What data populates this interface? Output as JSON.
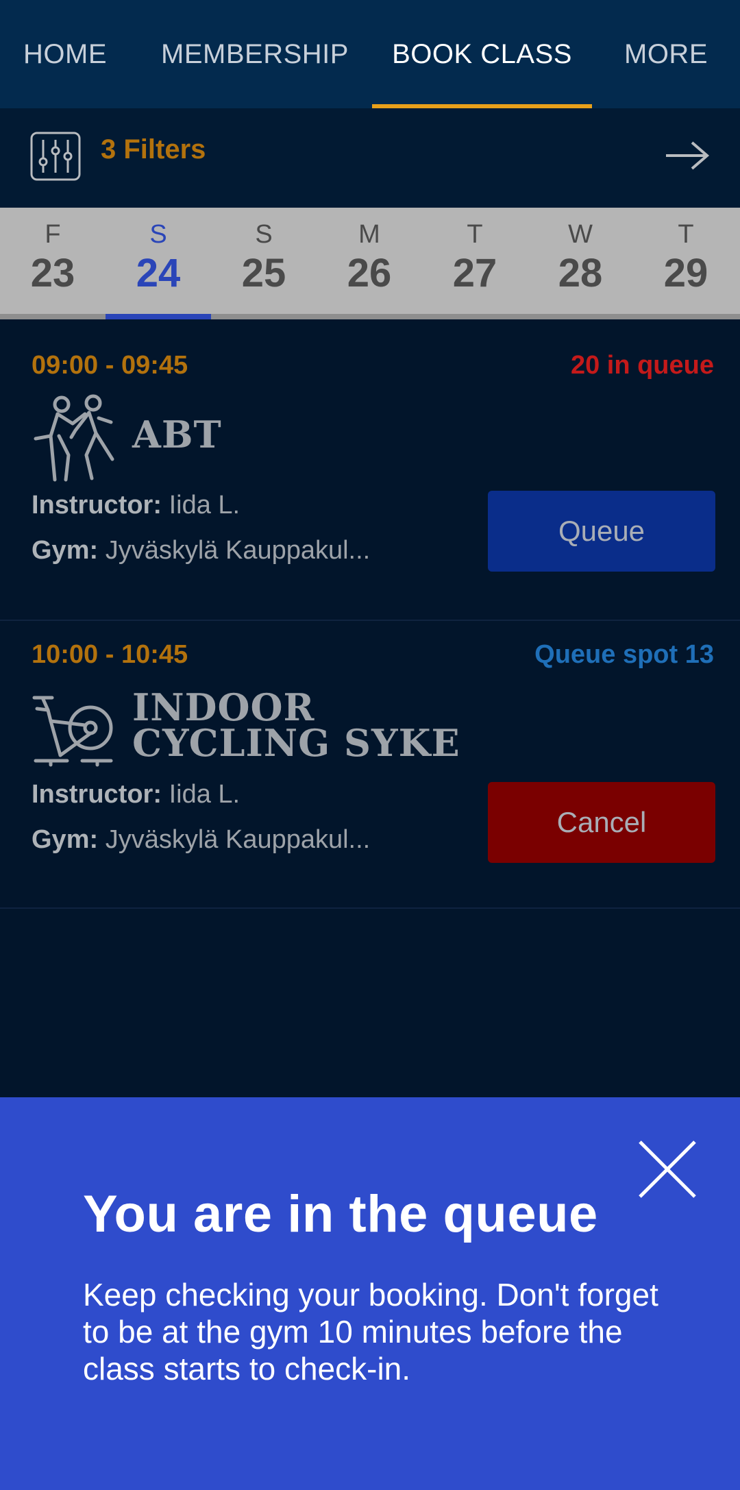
{
  "nav": {
    "items": [
      {
        "label": "HOME"
      },
      {
        "label": "MEMBERSHIP"
      },
      {
        "label": "BOOK CLASS"
      },
      {
        "label": "MORE"
      }
    ],
    "active": "BOOK CLASS",
    "accent_color": "#e8a01a"
  },
  "filters": {
    "icon": "sliders-icon",
    "label": "3 Filters",
    "arrow_icon": "arrow-right-icon"
  },
  "dates": [
    {
      "letter": "F",
      "num": "23"
    },
    {
      "letter": "S",
      "num": "24"
    },
    {
      "letter": "S",
      "num": "25"
    },
    {
      "letter": "M",
      "num": "26"
    },
    {
      "letter": "T",
      "num": "27"
    },
    {
      "letter": "W",
      "num": "28"
    },
    {
      "letter": "T",
      "num": "29"
    }
  ],
  "selected_date": "24",
  "classes": [
    {
      "time": "09:00 - 09:45",
      "status": "20 in queue",
      "status_color": "#c41a1a",
      "icon": "dance-icon",
      "name": "ABT",
      "instructor_label": "Instructor:",
      "instructor": "Iida L.",
      "gym_label": "Gym:",
      "gym": "Jyväskylä Kauppakul...",
      "button": "Queue",
      "button_color": "#0a2d8a"
    },
    {
      "time": "10:00 - 10:45",
      "status": "Queue spot 13",
      "status_color": "#1f6fb8",
      "icon": "exercise-bike-icon",
      "name_line1": "INDOOR",
      "name_line2": "CYCLING SYKE",
      "instructor_label": "Instructor:",
      "instructor": "Iida L.",
      "gym_label": "Gym:",
      "gym": "Jyväskylä Kauppakul...",
      "button": "Cancel",
      "button_color": "#7a0000"
    }
  ],
  "sheet": {
    "title": "You are in the queue",
    "body": "Keep checking your booking. Don't forget to be at the gym 10 minutes before the class starts to check-in.",
    "close_icon": "close-icon",
    "background": "#2f4ccc"
  }
}
